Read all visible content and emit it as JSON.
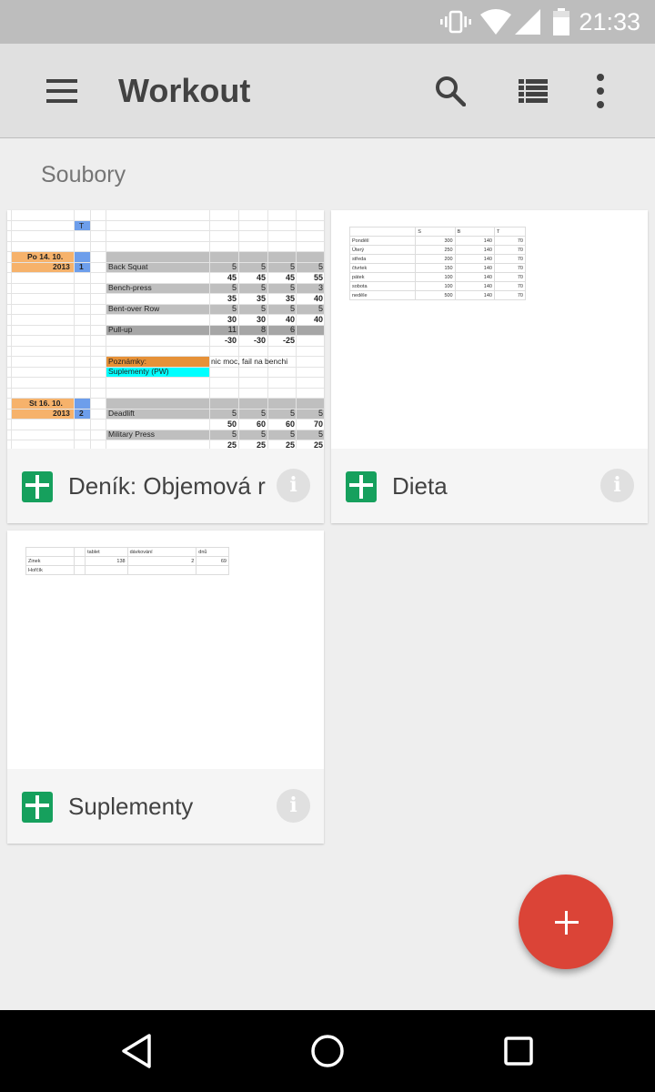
{
  "status_bar": {
    "time": "21:33",
    "icons": [
      "vibrate-icon",
      "wifi-icon",
      "signal-icon",
      "battery-icon"
    ]
  },
  "app_bar": {
    "title": "Workout",
    "menu_icon": "hamburger-menu-icon",
    "search_icon": "search-icon",
    "view_icon": "list-view-icon",
    "overflow_icon": "more-vert-icon"
  },
  "section": {
    "label": "Soubory"
  },
  "files": [
    {
      "title": "Deník: Objemová r",
      "preview": {
        "col_header": "T",
        "day1_label": "Po 14. 10.",
        "day1_year": "2013",
        "day1_num": "1",
        "rows": [
          {
            "name": "Back Squat",
            "reps": [
              "5",
              "5",
              "5",
              "5"
            ],
            "weights": [
              "45",
              "45",
              "45",
              "55"
            ]
          },
          {
            "name": "Bench-press",
            "reps": [
              "5",
              "5",
              "5",
              "3"
            ],
            "weights": [
              "35",
              "35",
              "35",
              "40"
            ]
          },
          {
            "name": "Bent-over Row",
            "reps": [
              "5",
              "5",
              "5",
              "5"
            ],
            "weights": [
              "30",
              "30",
              "40",
              "40"
            ]
          },
          {
            "name": "Pull-up",
            "reps": [
              "11",
              "8",
              "6",
              ""
            ],
            "weights": [
              "-30",
              "-30",
              "-25",
              ""
            ]
          }
        ],
        "notes_label": "Poznámky:",
        "notes_text": "nic moc, fail na benchi",
        "supplements_label": "Suplementy (PW)",
        "day2_label": "St 16. 10.",
        "day2_year": "2013",
        "day2_num": "2",
        "rows2": [
          {
            "name": "Deadlift",
            "reps": [
              "5",
              "5",
              "5",
              "5"
            ],
            "weights": [
              "50",
              "60",
              "60",
              "70"
            ]
          },
          {
            "name": "Military Press",
            "reps": [
              "5",
              "5",
              "5",
              "5"
            ],
            "weights": [
              "25",
              "25",
              "25",
              "25"
            ]
          }
        ]
      }
    },
    {
      "title": "Dieta",
      "preview": {
        "headers": [
          "",
          "S",
          "B",
          "T"
        ],
        "rows": [
          [
            "Pondělí",
            "300",
            "140",
            "70"
          ],
          [
            "Úterý",
            "250",
            "140",
            "70"
          ],
          [
            "středa",
            "200",
            "140",
            "70"
          ],
          [
            "čtvrtek",
            "150",
            "140",
            "70"
          ],
          [
            "pátek",
            "100",
            "140",
            "70"
          ],
          [
            "sobota",
            "100",
            "140",
            "70"
          ],
          [
            "neděle",
            "500",
            "140",
            "70"
          ]
        ]
      }
    },
    {
      "title": "Suplementy",
      "preview": {
        "headers": [
          "",
          "",
          "tablet",
          "dávkování",
          "dnů"
        ],
        "rows": [
          [
            "Zinek",
            "",
            "138",
            "2",
            "69"
          ],
          [
            "Hořčík",
            "",
            "",
            "",
            ""
          ]
        ]
      }
    }
  ],
  "fab": {
    "icon": "plus-icon"
  },
  "nav": {
    "back": "back-icon",
    "home": "home-icon",
    "recents": "recents-icon"
  },
  "colors": {
    "accent": "#db4437",
    "sheets_green": "#16a05d",
    "app_bar": "#e0e0e0",
    "status_bar": "#bdbdbd"
  }
}
